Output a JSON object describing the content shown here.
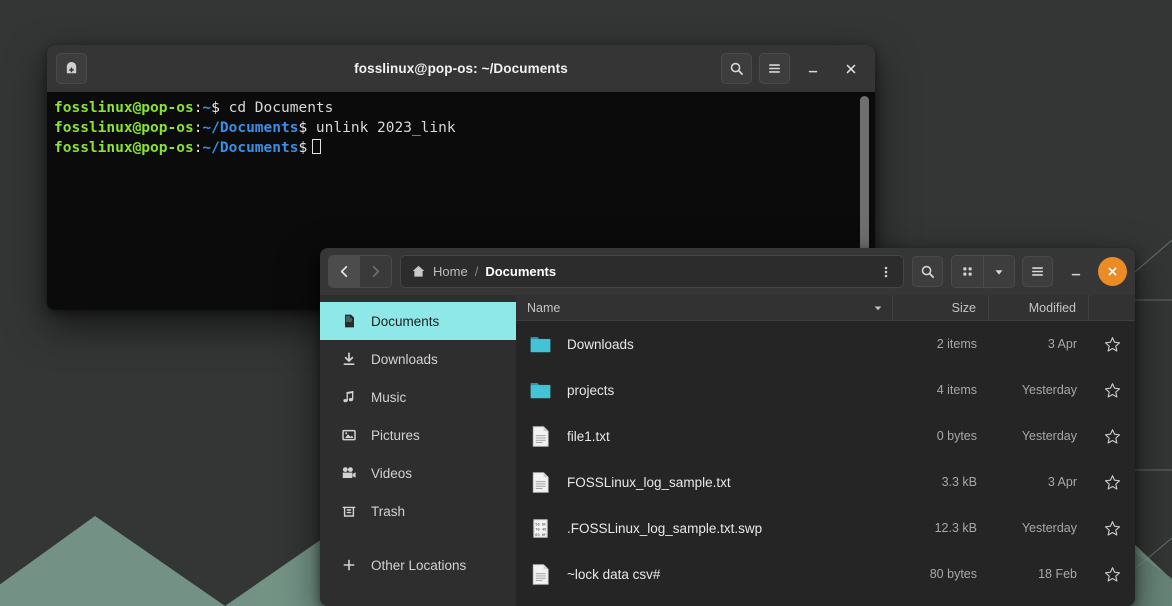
{
  "desktop": {
    "wallpaper_base": "#333634",
    "wallpaper_accent": "#7fa394",
    "wallpaper_line": "#7d938c"
  },
  "terminal": {
    "title": "fosslinux@pop-os: ~/Documents",
    "new_tab_icon": "new-tab-icon",
    "search_icon": "search-icon",
    "menu_icon": "hamburger-menu-icon",
    "minimize_icon": "minimize-icon",
    "close_icon": "close-icon",
    "colors": {
      "user": "#8ae234",
      "path": "#3a8ee6",
      "text": "#e8e8e8",
      "background": "#0b0b0b"
    },
    "lines": [
      {
        "user": "fosslinux@pop-os",
        "colon": ":",
        "path": "~",
        "dollar": "$",
        "command": " cd Documents"
      },
      {
        "user": "fosslinux@pop-os",
        "colon": ":",
        "path": "~/Documents",
        "dollar": "$",
        "command": " unlink 2023_link"
      },
      {
        "user": "fosslinux@pop-os",
        "colon": ":",
        "path": "~/Documents",
        "dollar": "$",
        "command": ""
      }
    ]
  },
  "files": {
    "nav": {
      "back_icon": "chevron-left-icon",
      "forward_icon": "chevron-right-icon"
    },
    "breadcrumb": {
      "home_icon": "home-icon",
      "home_label": "Home",
      "separator": "/",
      "current_label": "Documents"
    },
    "pathbar_menu_icon": "vertical-dots-icon",
    "search_icon": "search-icon",
    "view_grid_icon": "grid-view-icon",
    "view_dropdown_icon": "chevron-down-icon",
    "menu_icon": "hamburger-menu-icon",
    "minimize_icon": "minimize-icon",
    "close_icon": "close-icon",
    "close_button_color": "#eb8b25",
    "selected_sidebar_color": "#8ee8e8",
    "sidebar": [
      {
        "label": "Documents",
        "icon": "documents-icon",
        "selected": true
      },
      {
        "label": "Downloads",
        "icon": "downloads-icon",
        "selected": false
      },
      {
        "label": "Music",
        "icon": "music-note-icon",
        "selected": false
      },
      {
        "label": "Pictures",
        "icon": "pictures-icon",
        "selected": false
      },
      {
        "label": "Videos",
        "icon": "videos-camera-icon",
        "selected": false
      },
      {
        "label": "Trash",
        "icon": "trash-icon",
        "selected": false
      },
      {
        "label": "Other Locations",
        "icon": "plus-icon",
        "selected": false
      }
    ],
    "columns": {
      "name": "Name",
      "size": "Size",
      "modified": "Modified",
      "sort_caret_icon": "sort-descending-caret-icon"
    },
    "rows": [
      {
        "name": "Downloads",
        "size": "2 items",
        "modified": "3 Apr",
        "icon": "folder-icon",
        "star_icon": "star-outline-icon"
      },
      {
        "name": "projects",
        "size": "4 items",
        "modified": "Yesterday",
        "icon": "folder-icon",
        "star_icon": "star-outline-icon"
      },
      {
        "name": "file1.txt",
        "size": "0 bytes",
        "modified": "Yesterday",
        "icon": "text-file-icon",
        "star_icon": "star-outline-icon"
      },
      {
        "name": "FOSSLinux_log_sample.txt",
        "size": "3.3 kB",
        "modified": "3 Apr",
        "icon": "text-file-icon",
        "star_icon": "star-outline-icon"
      },
      {
        "name": ".FOSSLinux_log_sample.txt.swp",
        "size": "12.3 kB",
        "modified": "Yesterday",
        "icon": "binary-file-icon",
        "star_icon": "star-outline-icon"
      },
      {
        "name": "~lock data csv#",
        "size": "80 bytes",
        "modified": "18 Feb",
        "icon": "text-file-icon",
        "star_icon": "star-outline-icon"
      }
    ]
  }
}
